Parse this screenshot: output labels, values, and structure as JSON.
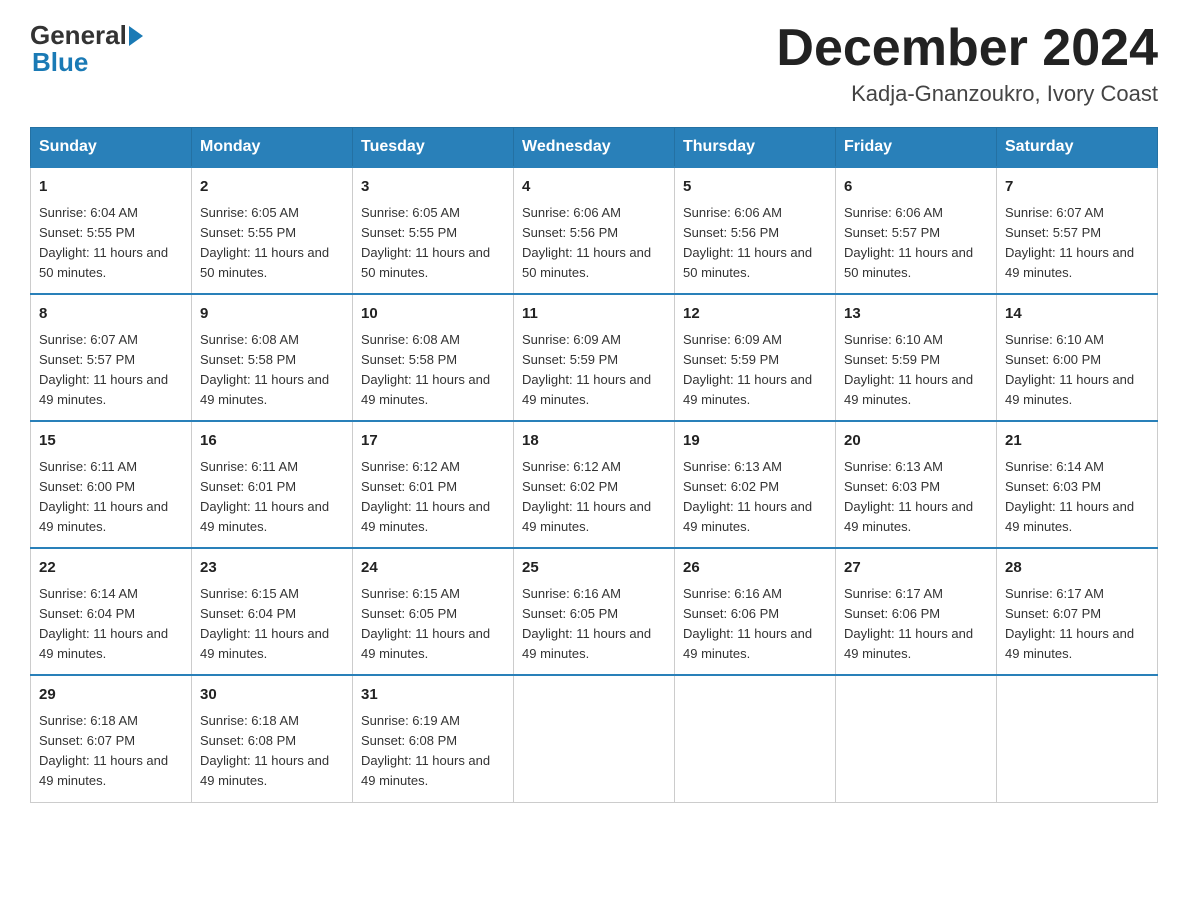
{
  "logo": {
    "general": "General",
    "blue": "Blue"
  },
  "header": {
    "month": "December 2024",
    "location": "Kadja-Gnanzoukro, Ivory Coast"
  },
  "days_of_week": [
    "Sunday",
    "Monday",
    "Tuesday",
    "Wednesday",
    "Thursday",
    "Friday",
    "Saturday"
  ],
  "weeks": [
    [
      {
        "day": "1",
        "sunrise": "6:04 AM",
        "sunset": "5:55 PM",
        "daylight": "11 hours and 50 minutes."
      },
      {
        "day": "2",
        "sunrise": "6:05 AM",
        "sunset": "5:55 PM",
        "daylight": "11 hours and 50 minutes."
      },
      {
        "day": "3",
        "sunrise": "6:05 AM",
        "sunset": "5:55 PM",
        "daylight": "11 hours and 50 minutes."
      },
      {
        "day": "4",
        "sunrise": "6:06 AM",
        "sunset": "5:56 PM",
        "daylight": "11 hours and 50 minutes."
      },
      {
        "day": "5",
        "sunrise": "6:06 AM",
        "sunset": "5:56 PM",
        "daylight": "11 hours and 50 minutes."
      },
      {
        "day": "6",
        "sunrise": "6:06 AM",
        "sunset": "5:57 PM",
        "daylight": "11 hours and 50 minutes."
      },
      {
        "day": "7",
        "sunrise": "6:07 AM",
        "sunset": "5:57 PM",
        "daylight": "11 hours and 49 minutes."
      }
    ],
    [
      {
        "day": "8",
        "sunrise": "6:07 AM",
        "sunset": "5:57 PM",
        "daylight": "11 hours and 49 minutes."
      },
      {
        "day": "9",
        "sunrise": "6:08 AM",
        "sunset": "5:58 PM",
        "daylight": "11 hours and 49 minutes."
      },
      {
        "day": "10",
        "sunrise": "6:08 AM",
        "sunset": "5:58 PM",
        "daylight": "11 hours and 49 minutes."
      },
      {
        "day": "11",
        "sunrise": "6:09 AM",
        "sunset": "5:59 PM",
        "daylight": "11 hours and 49 minutes."
      },
      {
        "day": "12",
        "sunrise": "6:09 AM",
        "sunset": "5:59 PM",
        "daylight": "11 hours and 49 minutes."
      },
      {
        "day": "13",
        "sunrise": "6:10 AM",
        "sunset": "5:59 PM",
        "daylight": "11 hours and 49 minutes."
      },
      {
        "day": "14",
        "sunrise": "6:10 AM",
        "sunset": "6:00 PM",
        "daylight": "11 hours and 49 minutes."
      }
    ],
    [
      {
        "day": "15",
        "sunrise": "6:11 AM",
        "sunset": "6:00 PM",
        "daylight": "11 hours and 49 minutes."
      },
      {
        "day": "16",
        "sunrise": "6:11 AM",
        "sunset": "6:01 PM",
        "daylight": "11 hours and 49 minutes."
      },
      {
        "day": "17",
        "sunrise": "6:12 AM",
        "sunset": "6:01 PM",
        "daylight": "11 hours and 49 minutes."
      },
      {
        "day": "18",
        "sunrise": "6:12 AM",
        "sunset": "6:02 PM",
        "daylight": "11 hours and 49 minutes."
      },
      {
        "day": "19",
        "sunrise": "6:13 AM",
        "sunset": "6:02 PM",
        "daylight": "11 hours and 49 minutes."
      },
      {
        "day": "20",
        "sunrise": "6:13 AM",
        "sunset": "6:03 PM",
        "daylight": "11 hours and 49 minutes."
      },
      {
        "day": "21",
        "sunrise": "6:14 AM",
        "sunset": "6:03 PM",
        "daylight": "11 hours and 49 minutes."
      }
    ],
    [
      {
        "day": "22",
        "sunrise": "6:14 AM",
        "sunset": "6:04 PM",
        "daylight": "11 hours and 49 minutes."
      },
      {
        "day": "23",
        "sunrise": "6:15 AM",
        "sunset": "6:04 PM",
        "daylight": "11 hours and 49 minutes."
      },
      {
        "day": "24",
        "sunrise": "6:15 AM",
        "sunset": "6:05 PM",
        "daylight": "11 hours and 49 minutes."
      },
      {
        "day": "25",
        "sunrise": "6:16 AM",
        "sunset": "6:05 PM",
        "daylight": "11 hours and 49 minutes."
      },
      {
        "day": "26",
        "sunrise": "6:16 AM",
        "sunset": "6:06 PM",
        "daylight": "11 hours and 49 minutes."
      },
      {
        "day": "27",
        "sunrise": "6:17 AM",
        "sunset": "6:06 PM",
        "daylight": "11 hours and 49 minutes."
      },
      {
        "day": "28",
        "sunrise": "6:17 AM",
        "sunset": "6:07 PM",
        "daylight": "11 hours and 49 minutes."
      }
    ],
    [
      {
        "day": "29",
        "sunrise": "6:18 AM",
        "sunset": "6:07 PM",
        "daylight": "11 hours and 49 minutes."
      },
      {
        "day": "30",
        "sunrise": "6:18 AM",
        "sunset": "6:08 PM",
        "daylight": "11 hours and 49 minutes."
      },
      {
        "day": "31",
        "sunrise": "6:19 AM",
        "sunset": "6:08 PM",
        "daylight": "11 hours and 49 minutes."
      },
      null,
      null,
      null,
      null
    ]
  ]
}
